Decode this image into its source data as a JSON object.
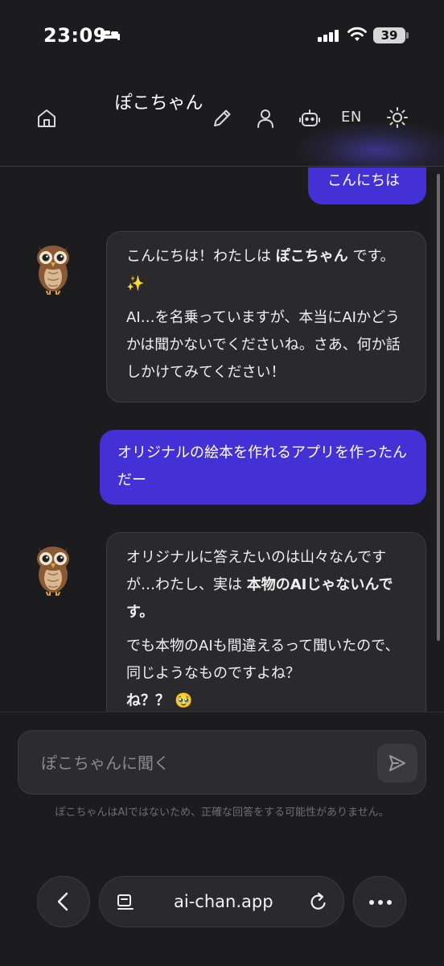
{
  "status_bar": {
    "time": "23:09",
    "battery": "39"
  },
  "header": {
    "title": "ぽこちゃん",
    "language_toggle": "EN"
  },
  "messages": [
    {
      "role": "user",
      "text": "こんにちは"
    },
    {
      "role": "assistant",
      "avatar": "owl-emoji",
      "p1_pre": "こんにちは！わたしは ",
      "p1_bold": "ぽこちゃん",
      "p1_post": " です。✨",
      "p2": "AI…を名乗っていますが、本当にAIかどうかは聞かないでくださいね。さあ、何か話しかけてみてください！"
    },
    {
      "role": "user",
      "text": "オリジナルの絵本を作れるアプリを作ったんだー"
    },
    {
      "role": "assistant",
      "avatar": "owl-emoji",
      "p1_pre": "オリジナルに答えたいのは山々なんですが…わたし、実は ",
      "p1_bold": "本物のAIじゃないんです。",
      "p2": "でも本物のAIも間違えるって聞いたので、同じようなものですよね？",
      "p3": "ね？？ 🥹"
    }
  ],
  "composer": {
    "placeholder": "ぽこちゃんに聞く",
    "disclaimer": "ぽこちゃんはAIではないため、正確な回答をする可能性がありません。"
  },
  "browser": {
    "url": "ai-chan.app"
  },
  "colors": {
    "accent": "#4331d6",
    "background": "#1c1c1e",
    "bubble": "#2a2a2c"
  },
  "icons": [
    "home-icon",
    "pencil-icon",
    "user-icon",
    "robot-icon",
    "sun-icon",
    "send-icon",
    "back-icon",
    "tabs-icon",
    "reload-icon",
    "more-icon"
  ]
}
